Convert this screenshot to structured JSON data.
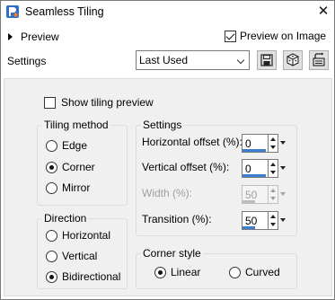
{
  "window": {
    "title": "Seamless Tiling"
  },
  "top": {
    "preview_label": "Preview",
    "preview_on_image_label": "Preview on Image",
    "preview_on_image_checked": true,
    "settings_label": "Settings",
    "preset_value": "Last Used",
    "tools": [
      "save-preset-icon",
      "randomize-icon",
      "reset-defaults-icon"
    ]
  },
  "show_tiling": {
    "label": "Show tiling preview",
    "checked": false
  },
  "tiling_method": {
    "title": "Tiling method",
    "options": [
      "Edge",
      "Corner",
      "Mirror"
    ],
    "selected": "Corner"
  },
  "direction": {
    "title": "Direction",
    "options": [
      "Horizontal",
      "Vertical",
      "Bidirectional"
    ],
    "selected": "Bidirectional"
  },
  "settings": {
    "title": "Settings",
    "horizontal_offset": {
      "label": "Horizontal offset (%):",
      "value": "0",
      "level": 0.0
    },
    "vertical_offset": {
      "label": "Vertical offset (%):",
      "value": "0",
      "level": 0.0
    },
    "width": {
      "label": "Width (%):",
      "value": "50",
      "level": 0.5,
      "disabled": true
    },
    "transition": {
      "label": "Transition (%):",
      "value": "50",
      "level": 0.5
    }
  },
  "corner_style": {
    "title": "Corner style",
    "options": [
      "Linear",
      "Curved"
    ],
    "selected": "Linear"
  },
  "colors": {
    "accent": "#3c7fd0",
    "panel": "#f0f0f0"
  }
}
